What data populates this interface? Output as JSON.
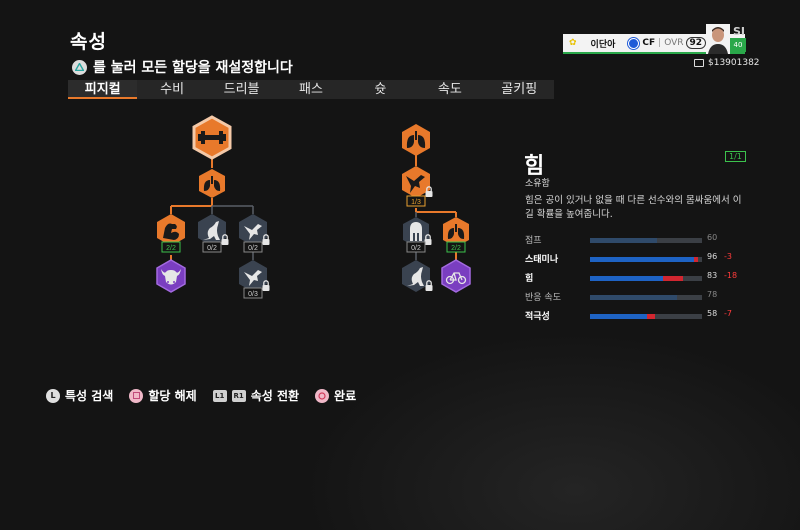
{
  "header": {
    "title": "속성",
    "reset_hint": "를 눌러 모든 할당을 재설정합니다"
  },
  "tabs": [
    {
      "label": "피지컬",
      "active": true
    },
    {
      "label": "수비",
      "active": false
    },
    {
      "label": "드리블",
      "active": false
    },
    {
      "label": "패스",
      "active": false
    },
    {
      "label": "슛",
      "active": false
    },
    {
      "label": "속도",
      "active": false
    },
    {
      "label": "골키핑",
      "active": false
    }
  ],
  "player": {
    "name": "이단아",
    "position": "CF",
    "ovr_label": "OVR",
    "ovr": "92",
    "level": "SI",
    "rating": "40",
    "money": "$13901382"
  },
  "tree": {
    "left_badges": [
      "2/2",
      "0/2",
      "0/2",
      "0/3"
    ],
    "right_badges": [
      "1/3",
      "0/2",
      "2/2"
    ]
  },
  "detail": {
    "title": "힘",
    "owned": "소유함",
    "count": "1/1",
    "description": "힘은 공이 있거나 없을 때 다른 선수와의 몸싸움에서 이길 확률을 높여줍니다.",
    "stats": [
      {
        "name": "점프",
        "value": "60",
        "base": 60,
        "delta": "",
        "loss": 0,
        "highlight": false
      },
      {
        "name": "스태미나",
        "value": "96",
        "base": 96,
        "delta": "-3",
        "loss": 3,
        "highlight": true
      },
      {
        "name": "힘",
        "value": "83",
        "base": 83,
        "delta": "-18",
        "loss": 18,
        "highlight": true
      },
      {
        "name": "반응 속도",
        "value": "78",
        "base": 78,
        "delta": "",
        "loss": 0,
        "highlight": false
      },
      {
        "name": "적극성",
        "value": "58",
        "base": 58,
        "delta": "-7",
        "loss": 7,
        "highlight": true
      }
    ]
  },
  "footer": [
    {
      "key": "L",
      "label": "특성 검색"
    },
    {
      "key": "□",
      "label": "할당 해제"
    },
    {
      "key": "L1 R1",
      "label": "속성 전환"
    },
    {
      "key": "○",
      "label": "완료"
    }
  ],
  "colors": {
    "accent": "#e8792b",
    "locked": "#3a4350",
    "purple": "#7a3ec0",
    "stat_bar": "#1e63c4",
    "stat_loss": "#d22630",
    "owned_green": "#3cc24d"
  },
  "icons": [
    "dumbbell-icon",
    "lungs-icon",
    "flexed-arm-icon",
    "kangaroo-icon",
    "hummingbird-icon",
    "bull-icon",
    "spartan-helmet-icon",
    "bicycle-icon",
    "lock-icon"
  ]
}
